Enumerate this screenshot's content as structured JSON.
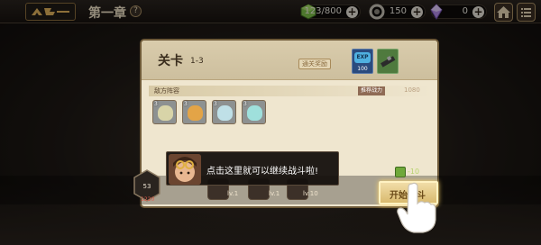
{
  "header": {
    "title": "第一章",
    "help_icon": "?",
    "resources": [
      {
        "name": "energy",
        "icon": "energy-cube-icon",
        "value": "123/800"
      },
      {
        "name": "coin",
        "icon": "ring-coin-icon",
        "value": "150"
      },
      {
        "name": "gem",
        "icon": "crystal-icon",
        "value": "0"
      }
    ],
    "plus": "+"
  },
  "dialog": {
    "stage_label": "关卡",
    "stage_number": "1-3",
    "reward_label": "通关奖励",
    "rewards": [
      {
        "name": "EXP",
        "value": "100"
      }
    ],
    "enemy_section_label": "敌方阵容",
    "recommend_label": "推荐战力",
    "recommend_value": "1080",
    "enemies": [
      {
        "level": "3",
        "color": "#d8d4a8"
      },
      {
        "level": "3",
        "color": "#e3a447"
      },
      {
        "level": "3",
        "color": "#bfe0e7"
      },
      {
        "level": "3",
        "color": "#9fe0dc"
      }
    ]
  },
  "bottom": {
    "leader_value": "53",
    "hp_value": "1220",
    "characters": [
      {
        "level": "lv.1"
      },
      {
        "level": "lv.1"
      },
      {
        "level": "lv.10"
      }
    ],
    "cost_value": "-10",
    "start_button": "开始战斗"
  },
  "tutorial": {
    "text": "点击这里就可以继续战斗啦!"
  },
  "colors": {
    "panel_bg": "#efe6cf",
    "accent_gold": "#d9ba6f",
    "energy_green": "#6fa83a"
  }
}
